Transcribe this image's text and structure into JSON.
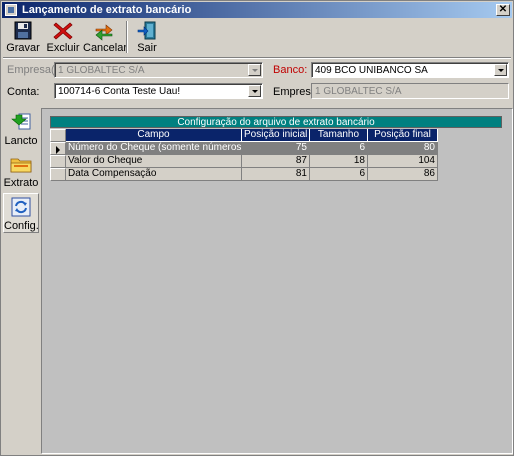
{
  "window": {
    "title": "Lançamento de extrato bancário",
    "close_glyph": "✕"
  },
  "toolbar": {
    "buttons": [
      {
        "label": "Gravar",
        "icon": "floppy-disk-icon"
      },
      {
        "label": "Excluir",
        "icon": "red-x-icon"
      },
      {
        "label": "Cancelar",
        "icon": "refresh-arrows-icon"
      },
      {
        "label": "Sair",
        "icon": "exit-door-icon"
      }
    ]
  },
  "form": {
    "empresas_label": "Empresa(s):",
    "empresas_value": "1  GLOBALTEC S/A",
    "banco_label": "Banco:",
    "banco_value": "409  BCO UNIBANCO SA",
    "conta_label": "Conta:",
    "conta_value": "100714-6  Conta Teste Uau!",
    "empresa_label": "Empresa:",
    "empresa_value": "1  GLOBALTEC S/A"
  },
  "sidebar": {
    "items": [
      {
        "label": "Lancto",
        "icon": "download-green-arrow-icon"
      },
      {
        "label": "Extrato",
        "icon": "folder-icon"
      },
      {
        "label": "Config.",
        "icon": "config-refresh-icon"
      }
    ]
  },
  "grid": {
    "caption": "Configuração do arquivo de extrato bancário",
    "columns": [
      "Campo",
      "Posição inicial",
      "Tamanho",
      "Posição final"
    ],
    "rows": [
      [
        "Número do Cheque (somente números)",
        "75",
        "6",
        "80"
      ],
      [
        "Valor do Cheque",
        "87",
        "18",
        "104"
      ],
      [
        "Data Compensação",
        "81",
        "6",
        "86"
      ]
    ],
    "selected_row": 0
  },
  "colors": {
    "titlebar_start": "#0a246a",
    "titlebar_end": "#a6caf0",
    "grid_caption": "#008080",
    "grid_header": "#0a246a",
    "selected_row": "#808080",
    "red_label": "#c00000"
  }
}
